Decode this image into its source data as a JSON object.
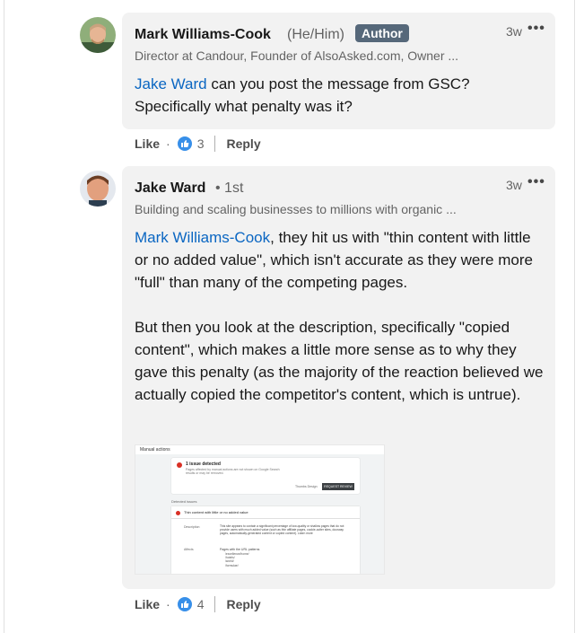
{
  "comments": [
    {
      "author": "Mark Williams-Cook",
      "pronouns": "(He/Him)",
      "badge": "Author",
      "headline": "Director at Candour, Founder of AlsoAsked.com, Owner ...",
      "time": "3w",
      "more": "•••",
      "mention": "Jake Ward",
      "text_line1": " can you post the message from GSC?",
      "text_line2": "Specifically what penalty was it?",
      "like": "Like",
      "reactions": "3",
      "reply": "Reply"
    },
    {
      "author": "Jake Ward",
      "degree": "• 1st",
      "headline": "Building and scaling businesses to millions with organic ...",
      "time": "3w",
      "more": "•••",
      "mention": "Mark Williams-Cook",
      "text_p1_after_mention": ", they hit us with \"thin content with little or no added value\", which isn't accurate as they were more \"full\" than many of the competing pages.",
      "text_p2": "But then you look at the description, specifically \"copied content\", which makes a little more sense as to why they gave this penalty (as the majority of the reaction believed we actually copied the competitor's content, which is untrue).",
      "like": "Like",
      "reactions": "4",
      "reply": "Reply",
      "screenshot": {
        "title": "Manual actions",
        "issues": "1 issue detected",
        "issues_desc": "Pages affected by manual actions are not shown on Google Search results or may be removed.",
        "btn_learn": "Thumbs Design",
        "btn_review": "REQUEST REVIEW",
        "detected_label": "Detected issues",
        "issue_title": "Thin content with little or no added value",
        "desc_label": "Description",
        "desc_text": "This site appears to contain a significant percentage of low-quality or shallow pages that do not provide users with much added value (such as thin affiliate pages, cookie-cutter sites, doorway pages, automatically-generated content or copied content). Learn more",
        "affects_label": "Affects",
        "affects_text": "Pages with the URL patterns",
        "paths": [
          "/excellence/home/",
          "/hotels/",
          "/world/",
          "/formulae/"
        ]
      }
    }
  ]
}
